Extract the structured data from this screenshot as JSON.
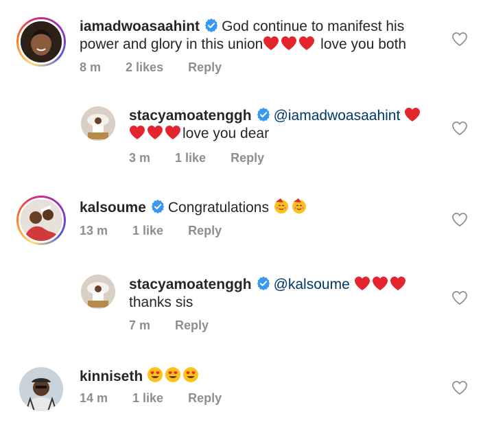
{
  "comments": [
    {
      "username": "iamadwoasaahint",
      "text_line1": "God continue to manifest his",
      "text_line2_pre": "power and glory in this union",
      "text_line2_post": " love you both",
      "time": "8 m",
      "likes": "2 likes",
      "reply": "Reply"
    },
    {
      "username": "stacyamoatenggh",
      "mention": "@iamadwoasaahint",
      "text": "love you dear",
      "time": "3 m",
      "likes": "1 like",
      "reply": "Reply"
    },
    {
      "username": "kalsoume",
      "text": "Congratulations ",
      "time": "13 m",
      "likes": "1 like",
      "reply": "Reply"
    },
    {
      "username": "stacyamoatenggh",
      "mention": "@kalsoume",
      "text": "thanks sis",
      "time": "7 m",
      "reply": "Reply"
    },
    {
      "username": "kinniseth",
      "time": "14 m",
      "likes": "1 like",
      "reply": "Reply"
    }
  ],
  "colors": {
    "heart": "#e5252e",
    "verified": "#3897f0",
    "mention": "#00376b",
    "meta": "#8e8e8e"
  }
}
